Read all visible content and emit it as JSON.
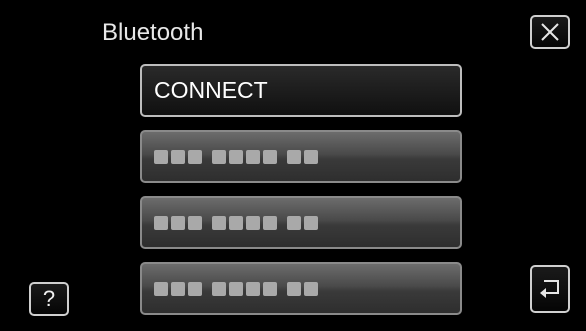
{
  "header": {
    "title": "Bluetooth",
    "close_icon": "close-icon"
  },
  "menu": {
    "connect_label": "CONNECT",
    "device_slots": [
      {
        "masked": true
      },
      {
        "masked": true
      },
      {
        "masked": true
      }
    ]
  },
  "footer": {
    "help_label": "?",
    "back_icon": "return-icon"
  },
  "colors": {
    "background": "#000000",
    "button_border": "#cfcfcf",
    "text": "#ffffff"
  }
}
